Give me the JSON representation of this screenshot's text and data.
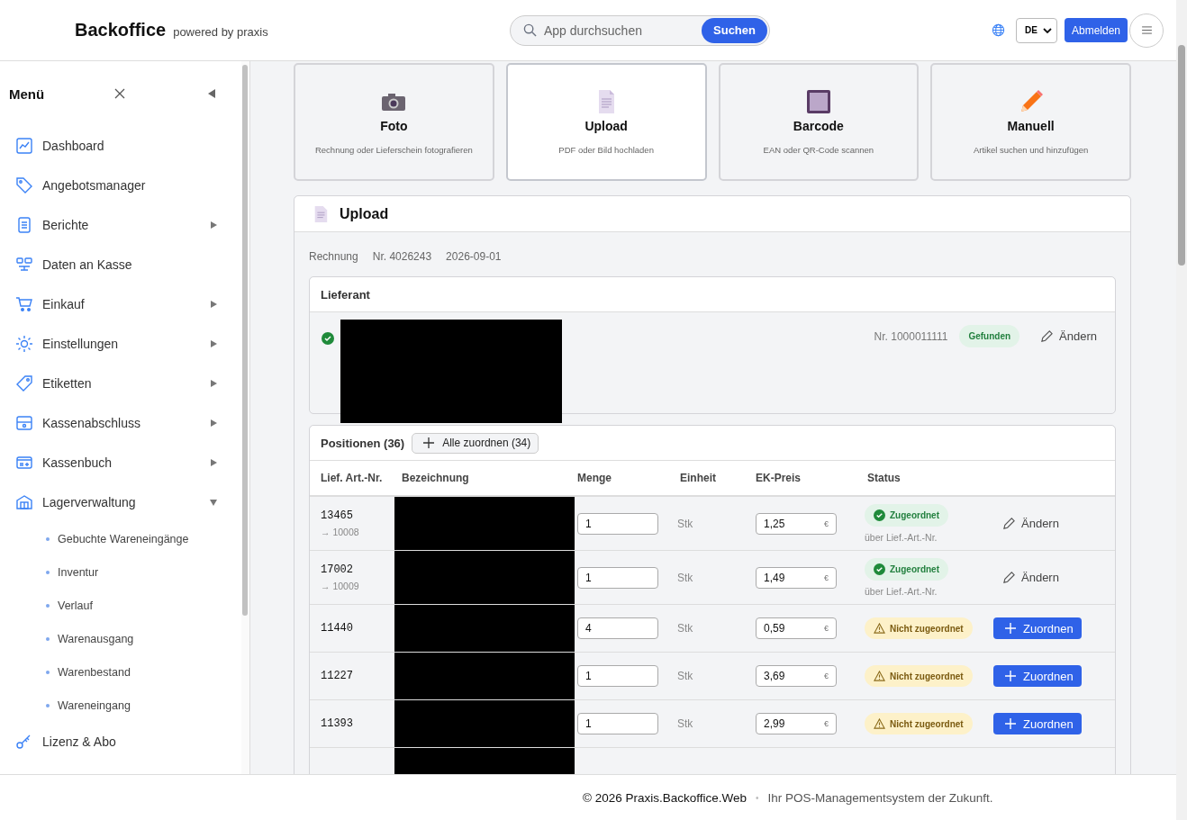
{
  "header": {
    "brand": "Backoffice",
    "tagline": "powered by praxis",
    "search": {
      "placeholder": "App durchsuchen",
      "button": "Suchen"
    },
    "language": "DE",
    "logout": "Abmelden"
  },
  "sidebar": {
    "title": "Menü",
    "items": [
      {
        "label": "Dashboard"
      },
      {
        "label": "Angebotsmanager"
      },
      {
        "label": "Berichte",
        "expanded": false
      },
      {
        "label": "Daten an Kasse"
      },
      {
        "label": "Einkauf",
        "expanded": false
      },
      {
        "label": "Einstellungen",
        "expanded": false
      },
      {
        "label": "Etiketten",
        "expanded": false
      },
      {
        "label": "Kassenabschluss",
        "expanded": false
      },
      {
        "label": "Kassenbuch",
        "expanded": false
      },
      {
        "label": "Lagerverwaltung",
        "expanded": true,
        "children": [
          {
            "label": "Gebuchte Wareneingänge"
          },
          {
            "label": "Inventur"
          },
          {
            "label": "Verlauf"
          },
          {
            "label": "Warenausgang"
          },
          {
            "label": "Warenbestand"
          },
          {
            "label": "Wareneingang"
          }
        ]
      },
      {
        "label": "Lizenz & Abo"
      }
    ]
  },
  "modes": [
    {
      "title": "Foto",
      "description": "Rechnung oder Lieferschein fotografieren",
      "selected": false
    },
    {
      "title": "Upload",
      "description": "PDF oder Bild hochladen",
      "selected": true
    },
    {
      "title": "Barcode",
      "description": "EAN oder QR-Code scannen",
      "selected": false
    },
    {
      "title": "Manuell",
      "description": "Artikel suchen und hinzufügen",
      "selected": false
    }
  ],
  "upload": {
    "title": "Upload",
    "meta": [
      "Rechnung",
      "Nr. 4026243",
      "2026-09-01"
    ],
    "supplier": {
      "title": "Lieferant",
      "number": "Nr. 1000011111",
      "badge": "Gefunden",
      "edit": "Ändern"
    },
    "positions": {
      "title": "Positionen (36)",
      "assign_all": "Alle zuordnen (34)",
      "columns": [
        "Lief. Art.-Nr.",
        "Bezeichnung",
        "Menge",
        "Einheit",
        "EK-Preis",
        "Status"
      ],
      "rows": [
        {
          "art_nr": "13465",
          "mapped": "→ 10008",
          "menge": "1",
          "einheit": "Stk",
          "preis": "1,25",
          "currency": "€",
          "status": {
            "kind": "assigned",
            "label": "Zugeordnet",
            "note": "über Lief.-Art.-Nr."
          },
          "action": {
            "kind": "edit",
            "label": "Ändern"
          }
        },
        {
          "art_nr": "17002",
          "mapped": "→ 10009",
          "menge": "1",
          "einheit": "Stk",
          "preis": "1,49",
          "currency": "€",
          "status": {
            "kind": "assigned",
            "label": "Zugeordnet",
            "note": "über Lief.-Art.-Nr."
          },
          "action": {
            "kind": "edit",
            "label": "Ändern"
          }
        },
        {
          "art_nr": "11440",
          "menge": "4",
          "einheit": "Stk",
          "preis": "0,59",
          "currency": "€",
          "status": {
            "kind": "unassigned",
            "label": "Nicht zugeordnet"
          },
          "action": {
            "kind": "assign",
            "label": "Zuordnen"
          }
        },
        {
          "art_nr": "11227",
          "menge": "1",
          "einheit": "Stk",
          "preis": "3,69",
          "currency": "€",
          "status": {
            "kind": "unassigned",
            "label": "Nicht zugeordnet"
          },
          "action": {
            "kind": "assign",
            "label": "Zuordnen"
          }
        },
        {
          "art_nr": "11393",
          "menge": "1",
          "einheit": "Stk",
          "preis": "2,99",
          "currency": "€",
          "status": {
            "kind": "unassigned",
            "label": "Nicht zugeordnet"
          },
          "action": {
            "kind": "assign",
            "label": "Zuordnen"
          }
        }
      ]
    }
  },
  "footer": {
    "copyright": "© 2026 Praxis.Backoffice.Web",
    "separator": "•",
    "slogan": "Ihr POS-Managementsystem der Zukunft."
  }
}
